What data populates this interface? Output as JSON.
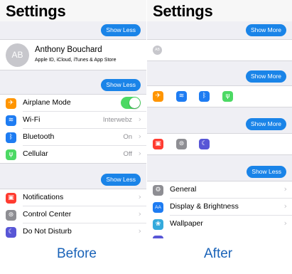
{
  "colors": {
    "accent": "#1a84e8",
    "orange": "#ff9500",
    "blue": "#1e7cf2",
    "green": "#4cd964",
    "red": "#ff3b30",
    "gray": "#8e8e93",
    "purple": "#5856d6"
  },
  "before": {
    "title": "Settings",
    "profile": {
      "pill": "Show Less",
      "initials": "AB",
      "name": "Anthony Bouchard",
      "subtitle": "Apple ID, iCloud, iTunes & App Store"
    },
    "connectivity": {
      "pill": "Show Less",
      "rows": [
        {
          "label": "Airplane Mode",
          "value": "",
          "icon": "airplane-icon"
        },
        {
          "label": "Wi-Fi",
          "value": "Interwebz",
          "icon": "wifi-icon"
        },
        {
          "label": "Bluetooth",
          "value": "On",
          "icon": "bluetooth-icon"
        },
        {
          "label": "Cellular",
          "value": "Off",
          "icon": "cellular-icon"
        }
      ]
    },
    "notifications": {
      "pill": "Show Less",
      "rows": [
        {
          "label": "Notifications",
          "icon": "notifications-icon"
        },
        {
          "label": "Control Center",
          "icon": "control-center-icon"
        },
        {
          "label": "Do Not Disturb",
          "icon": "moon-icon"
        }
      ]
    },
    "caption": "Before"
  },
  "after": {
    "title": "Settings",
    "profile": {
      "pill": "Show More",
      "initials": "AB"
    },
    "connectivity": {
      "pill": "Show More"
    },
    "notifications": {
      "pill": "Show More"
    },
    "general": {
      "pill": "Show Less",
      "rows": [
        {
          "label": "General",
          "icon": "gear-icon"
        },
        {
          "label": "Display & Brightness",
          "icon": "display-icon",
          "glyph": "AA"
        },
        {
          "label": "Wallpaper",
          "icon": "wallpaper-icon"
        }
      ]
    },
    "caption": "After"
  }
}
